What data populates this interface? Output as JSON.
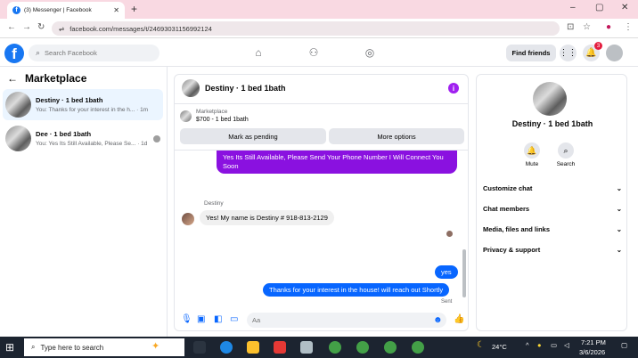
{
  "browser": {
    "tab_title": "(3) Messenger | Facebook",
    "url": "facebook.com/messages/t/24693031156992124"
  },
  "fb": {
    "search_placeholder": "Search Facebook",
    "find_friends": "Find friends",
    "notification_count": "3"
  },
  "sidebar": {
    "title": "Marketplace",
    "conversations": [
      {
        "name": "Destiny · 1 bed 1bath",
        "preview": "You: Thanks for your interest in the h...  · 1m"
      },
      {
        "name": "Dee · 1 bed 1bath",
        "preview": "You: Yes Its Still Available, Please Se...  · 1d"
      }
    ]
  },
  "chat": {
    "title": "Destiny · 1 bed 1bath",
    "listing_label": "Marketplace",
    "listing_detail": "$700 - 1 bed 1bath",
    "mark_pending": "Mark as pending",
    "more_options": "More options",
    "messages": [
      {
        "from": "me",
        "text": "Yes Its Still Available, Please Send Your Phone Number I Will Connect You Soon"
      },
      {
        "from": "Destiny",
        "text": "Yes! My name is Destiny # 918-813-2129"
      },
      {
        "from": "me",
        "text": "yes"
      },
      {
        "from": "me",
        "text": "Thanks for your interest in the house! will reach out Shortly"
      }
    ],
    "sender_label": "Destiny",
    "status": "Sent",
    "composer_placeholder": "Aa"
  },
  "details": {
    "name": "Destiny · 1 bed 1bath",
    "mute": "Mute",
    "search": "Search",
    "rows": [
      "Customize chat",
      "Chat members",
      "Media, files and links",
      "Privacy & support"
    ]
  },
  "taskbar": {
    "search_placeholder": "Type here to search",
    "temperature": "24°C",
    "time": "7:21 PM",
    "date": "3/6/2026"
  }
}
